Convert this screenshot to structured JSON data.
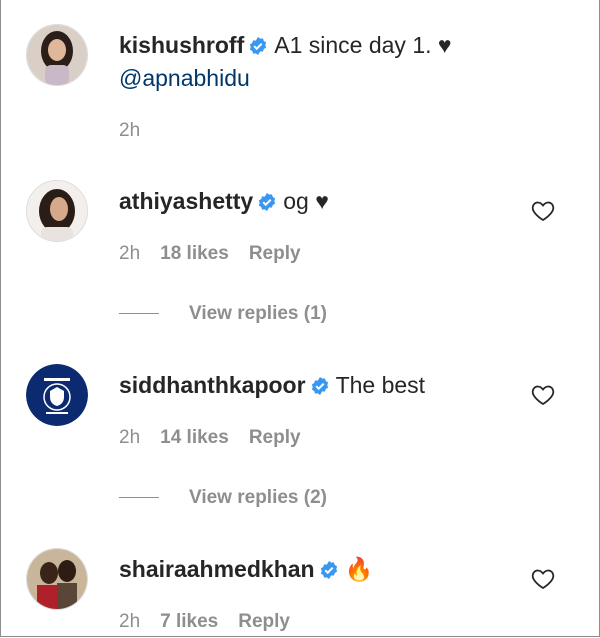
{
  "comments": [
    {
      "username": "kishushroff",
      "text": "A1 since day 1. ♥",
      "mention": "@apnabhidu",
      "time": "2h",
      "likes": "",
      "reply": "",
      "replies": ""
    },
    {
      "username": "athiyashetty",
      "text": "og ♥",
      "time": "2h",
      "likes": "18 likes",
      "reply": "Reply",
      "replies": "View replies (1)"
    },
    {
      "username": "siddhanthkapoor",
      "text": "The best",
      "time": "2h",
      "likes": "14 likes",
      "reply": "Reply",
      "replies": "View replies (2)"
    },
    {
      "username": "shairaahmedkhan",
      "text": "🔥",
      "time": "2h",
      "likes": "7 likes",
      "reply": "Reply",
      "replies": ""
    }
  ],
  "colors": {
    "verified": "#3897f0",
    "mention": "#00376b",
    "secondary_text": "#8e8e8e"
  },
  "icons": {
    "verified": "verified-badge-icon",
    "like": "heart-outline-icon"
  }
}
